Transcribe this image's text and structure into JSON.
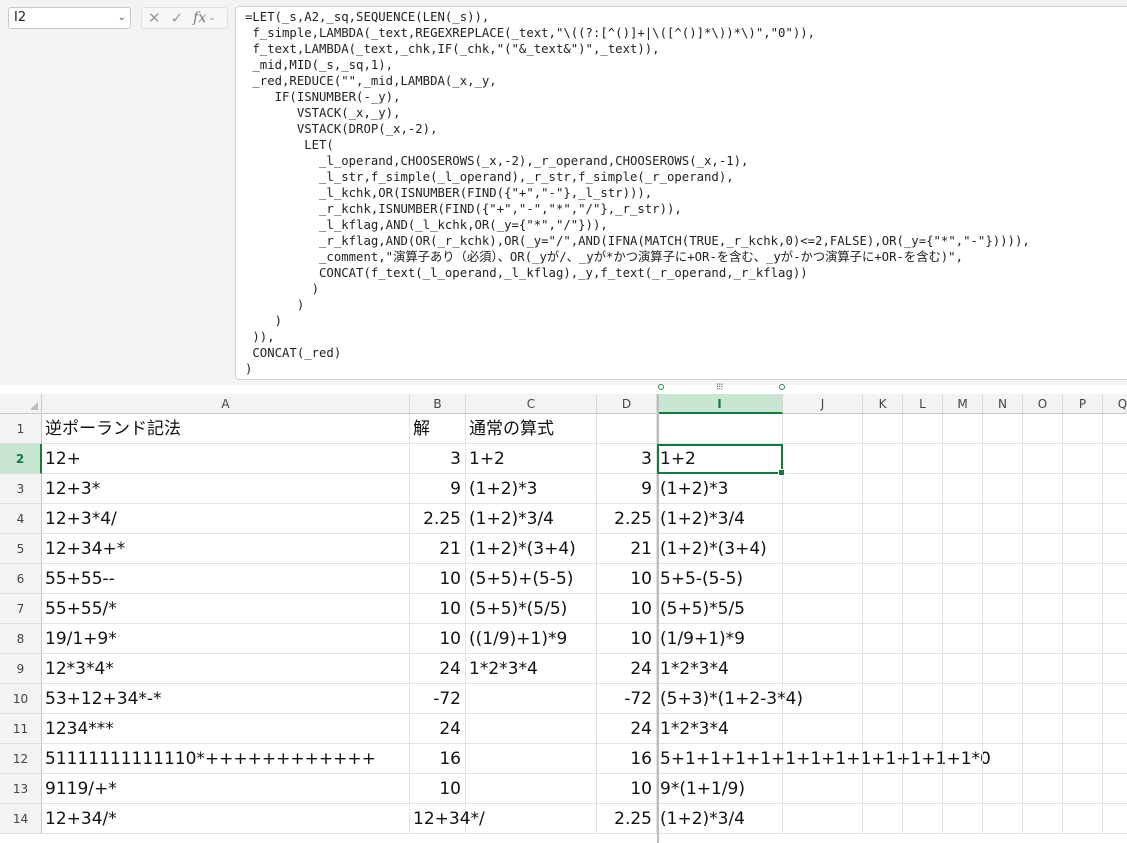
{
  "name_box": "I2",
  "formula_lines": [
    "=LET(_s,A2,_sq,SEQUENCE(LEN(_s)),",
    " f_simple,LAMBDA(_text,REGEXREPLACE(_text,\"\\((?:[^()]+|\\([^()]*\\))*\\)\",\"0\")),",
    " f_text,LAMBDA(_text,_chk,IF(_chk,\"(\"&_text&\")\",_text)),",
    " _mid,MID(_s,_sq,1),",
    " _red,REDUCE(\"\",_mid,LAMBDA(_x,_y,",
    "    IF(ISNUMBER(-_y),",
    "       VSTACK(_x,_y),",
    "       VSTACK(DROP(_x,-2),",
    "        LET(",
    "          _l_operand,CHOOSEROWS(_x,-2),_r_operand,CHOOSEROWS(_x,-1),",
    "          _l_str,f_simple(_l_operand),_r_str,f_simple(_r_operand),",
    "          _l_kchk,OR(ISNUMBER(FIND({\"+\",\"-\"},_l_str))),",
    "          _r_kchk,ISNUMBER(FIND({\"+\",\"-\",\"*\",\"/\"},_r_str)),",
    "          _l_kflag,AND(_l_kchk,OR(_y={\"*\",\"/\"})),",
    "          _r_kflag,AND(OR(_r_kchk),OR(_y=\"/\",AND(IFNA(MATCH(TRUE,_r_kchk,0)<=2,FALSE),OR(_y={\"*\",\"-\"})))),",
    "          _comment,\"演算子あり（必須）、OR(_yが/、_yが*かつ演算子に+OR-を含む、_yが-かつ演算子に+OR-を含む)\",",
    "          CONCAT(f_text(_l_operand,_l_kflag),_y,f_text(_r_operand,_r_kflag))",
    "         )",
    "       )",
    "    )",
    " )),",
    " CONCAT(_red)",
    ")"
  ],
  "columns": [
    {
      "label": "A"
    },
    {
      "label": "B"
    },
    {
      "label": "C"
    },
    {
      "label": "D"
    },
    {
      "label": "I"
    },
    {
      "label": "J"
    },
    {
      "label": "K"
    },
    {
      "label": "L"
    },
    {
      "label": "M"
    },
    {
      "label": "N"
    },
    {
      "label": "O"
    },
    {
      "label": "P"
    },
    {
      "label": "Q"
    }
  ],
  "rows": [
    {
      "n": "1",
      "a": "逆ポーランド記法",
      "b": "解",
      "c": "通常の算式",
      "d": "",
      "i": ""
    },
    {
      "n": "2",
      "a": "12+",
      "b": "3",
      "c": "1+2",
      "d": "3",
      "i": "1+2"
    },
    {
      "n": "3",
      "a": "12+3*",
      "b": "9",
      "c": "(1+2)*3",
      "d": "9",
      "i": "(1+2)*3"
    },
    {
      "n": "4",
      "a": "12+3*4/",
      "b": "2.25",
      "c": "(1+2)*3/4",
      "d": "2.25",
      "i": "(1+2)*3/4"
    },
    {
      "n": "5",
      "a": "12+34+*",
      "b": "21",
      "c": "(1+2)*(3+4)",
      "d": "21",
      "i": "(1+2)*(3+4)"
    },
    {
      "n": "6",
      "a": "55+55--",
      "b": "10",
      "c": "(5+5)+(5-5)",
      "d": "10",
      "i": "5+5-(5-5)"
    },
    {
      "n": "7",
      "a": "55+55/*",
      "b": "10",
      "c": "(5+5)*(5/5)",
      "d": "10",
      "i": "(5+5)*5/5"
    },
    {
      "n": "8",
      "a": "19/1+9*",
      "b": "10",
      "c": "((1/9)+1)*9",
      "d": "10",
      "i": "(1/9+1)*9"
    },
    {
      "n": "9",
      "a": "12*3*4*",
      "b": "24",
      "c": "1*2*3*4",
      "d": "24",
      "i": "1*2*3*4"
    },
    {
      "n": "10",
      "a": "53+12+34*-*",
      "b": "-72",
      "c": "",
      "d": "-72",
      "i": "(5+3)*(1+2-3*4)"
    },
    {
      "n": "11",
      "a": "1234***",
      "b": "24",
      "c": "",
      "d": "24",
      "i": "1*2*3*4"
    },
    {
      "n": "12",
      "a": "51111111111110*++++++++++++",
      "b": "16",
      "c": "",
      "d": "16",
      "i": "5+1+1+1+1+1+1+1+1+1+1+1+1*0"
    },
    {
      "n": "13",
      "a": "9119/+*",
      "b": "10",
      "c": "",
      "d": "10",
      "i": "9*(1+1/9)"
    },
    {
      "n": "14",
      "a": "12+34/*",
      "b": "12+34*/",
      "c": "",
      "d": "2.25",
      "i": "(1+2)*3/4"
    }
  ],
  "accent_color": "#107c41"
}
